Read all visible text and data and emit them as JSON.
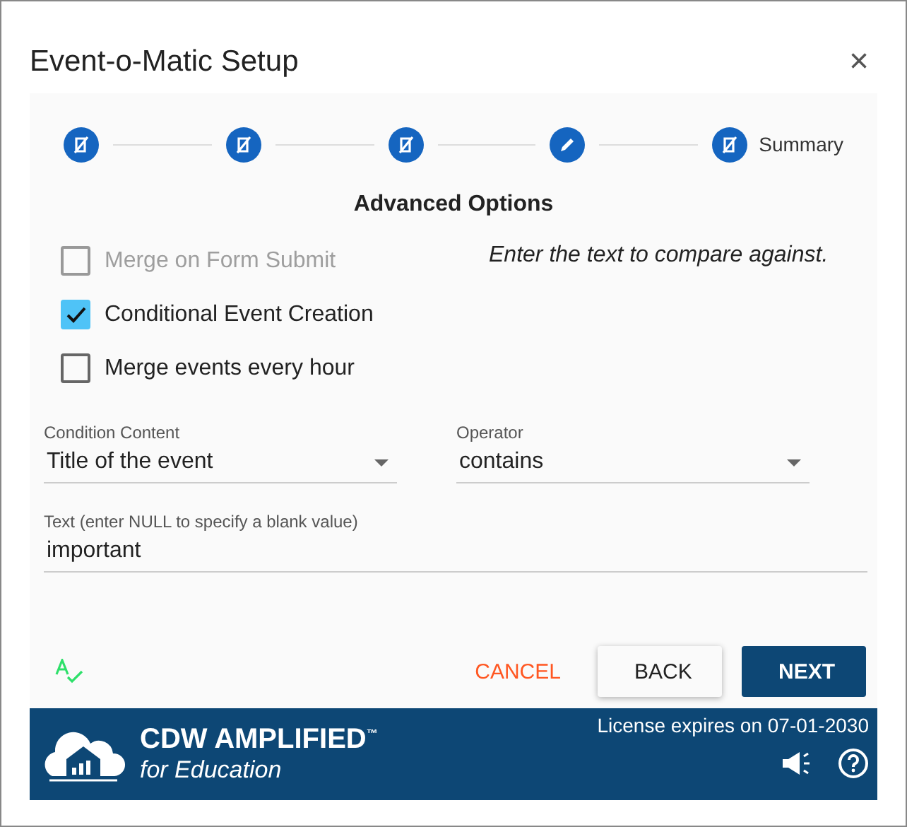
{
  "window": {
    "title": "Event-o-Matic Setup",
    "close": "×"
  },
  "steps": [
    {
      "kind": "done"
    },
    {
      "kind": "done"
    },
    {
      "kind": "done"
    },
    {
      "kind": "edit"
    },
    {
      "kind": "done",
      "label": "Summary"
    }
  ],
  "section_title": "Advanced Options",
  "options": [
    {
      "label": "Merge on Form Submit",
      "checked": false,
      "disabled": true
    },
    {
      "label": "Conditional Event Creation",
      "checked": true,
      "disabled": false
    },
    {
      "label": "Merge events every hour",
      "checked": false,
      "disabled": false
    }
  ],
  "hint": "Enter the text to compare against.",
  "fields": [
    {
      "label": "Condition Content",
      "value": "Title of the event",
      "kind": "dropdown"
    },
    {
      "label": "Operator",
      "value": "contains",
      "kind": "dropdown"
    },
    {
      "label": "Text (enter NULL to specify a blank value)",
      "value": "important",
      "kind": "text"
    }
  ],
  "buttons": [
    {
      "label": "CANCEL",
      "kind": "flat"
    },
    {
      "label": "BACK",
      "kind": "raised"
    },
    {
      "label": "NEXT",
      "kind": "primary"
    }
  ],
  "footer": {
    "logo_title": "CDW AMPLIFIED$^{™}$",
    "logo_subtitle": "for Education",
    "license": "License expires on 07-01-2030"
  }
}
